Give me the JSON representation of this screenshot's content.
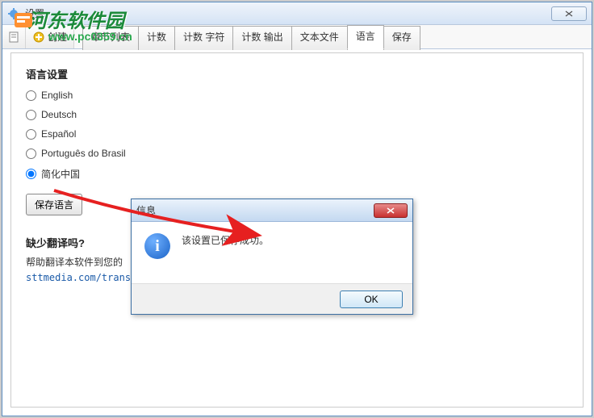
{
  "window": {
    "title": "设置"
  },
  "toolbar": {
    "create_label": "创建"
  },
  "tabs": [
    "章节列表",
    "计数",
    "计数 字符",
    "计数 输出",
    "文本文件",
    "语言",
    "保存"
  ],
  "active_tab_index": 5,
  "language": {
    "section_title": "语言设置",
    "options": [
      "English",
      "Deutsch",
      "Español",
      "Português do Brasil",
      "简化中国"
    ],
    "selected_index": 4,
    "save_button": "保存语言"
  },
  "missing": {
    "title": "缺少翻译吗?",
    "text": "帮助翻译本软件到您的",
    "link": "sttmedia.com/transl"
  },
  "dialog": {
    "title": "信息",
    "message": "该设置已保存成功。",
    "ok": "OK"
  },
  "watermark": {
    "main": "河东软件园",
    "sub": "www.pc0359.cn"
  }
}
